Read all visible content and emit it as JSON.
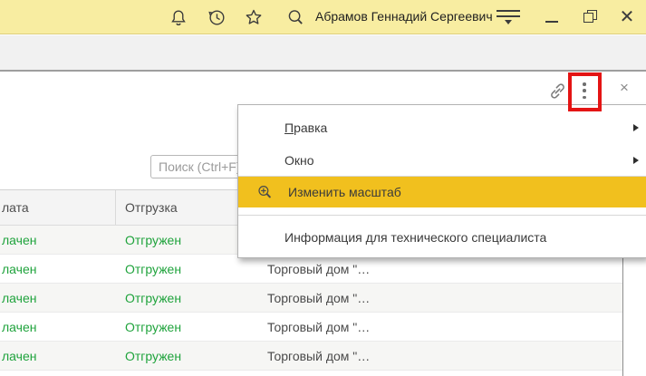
{
  "titlebar": {
    "user_name": "Абрамов Геннадий Сергеевич",
    "icons": [
      "notifications-icon",
      "history-icon",
      "favorites-icon",
      "search-icon",
      "service-menu-icon",
      "minimize-icon",
      "restore-icon",
      "close-icon"
    ],
    "background_color": "#f8eda1"
  },
  "form": {
    "search": {
      "placeholder": "Поиск (Ctrl+F)",
      "value": ""
    },
    "header_icons": [
      "link-icon",
      "more-actions-kebab-icon",
      "close-icon"
    ],
    "close_glyph": "×",
    "annotation": {
      "shape": "red-box-highlight",
      "target": "more-actions-kebab-icon",
      "color": "#e41414"
    }
  },
  "context_menu": {
    "highlight_color": "#f1c01e",
    "items": [
      {
        "label_head": "П",
        "label_tail": "равка",
        "has_submenu": true
      },
      {
        "label": "Окно",
        "has_submenu": true
      },
      {
        "label": "Изменить масштаб",
        "icon": "zoom-in-icon",
        "highlighted": true
      },
      {
        "label": "Информация для технического специалиста"
      }
    ]
  },
  "table": {
    "status_color": "#1fa33c",
    "columns": [
      {
        "label": "лата"
      },
      {
        "label": "Отгрузка"
      },
      {
        "label": ""
      }
    ],
    "rows": [
      {
        "payment": "лачен",
        "shipment": "Отгружен",
        "client": ""
      },
      {
        "payment": "лачен",
        "shipment": "Отгружен",
        "client": "Торговый дом \"…"
      },
      {
        "payment": "лачен",
        "shipment": "Отгружен",
        "client": "Торговый дом \"…"
      },
      {
        "payment": "лачен",
        "shipment": "Отгружен",
        "client": "Торговый дом \"…"
      },
      {
        "payment": "лачен",
        "shipment": "Отгружен",
        "client": "Торговый дом \"…"
      }
    ]
  }
}
